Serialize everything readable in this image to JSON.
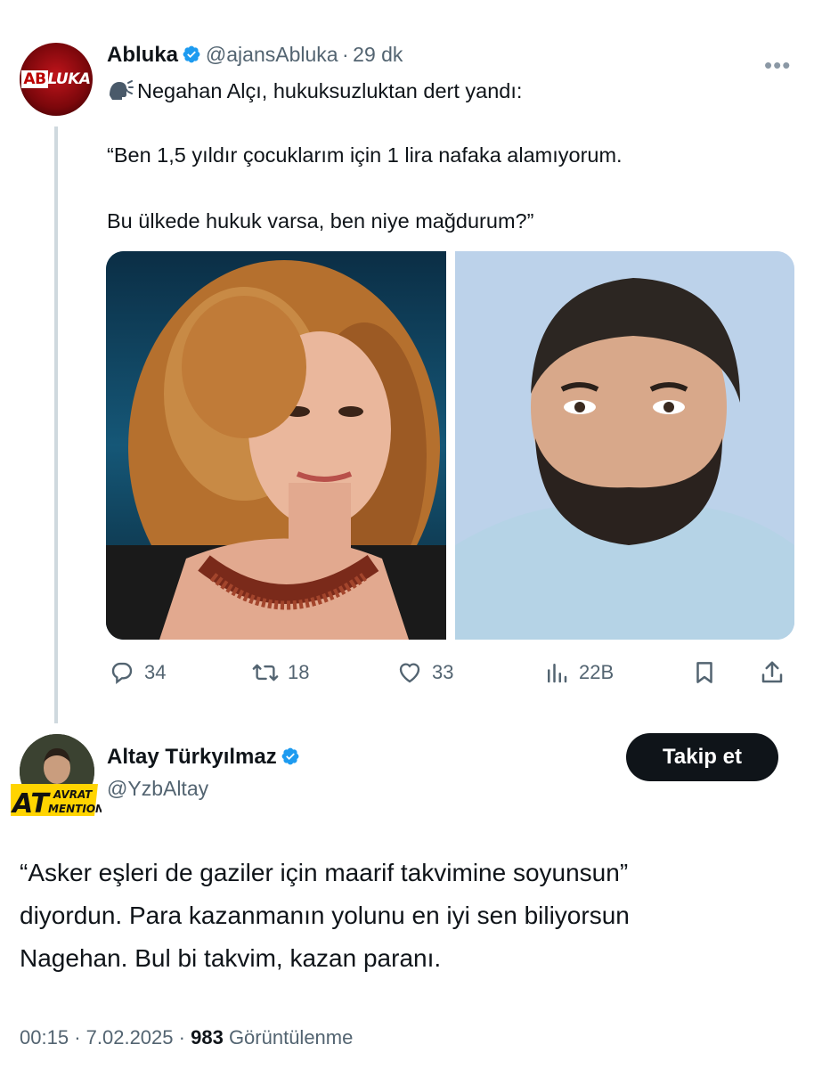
{
  "tweet1": {
    "author_name": "Abluka",
    "author_handle": "@ajansAbluka",
    "separator": "·",
    "time_ago": "29 dk",
    "avatar_text_ab": "AB",
    "avatar_text_luka": "LUKA",
    "text_line1": "Negahan Alçı, hukuksuzluktan dert yandı:",
    "text_line2": "“Ben 1,5 yıldır çocuklarım için 1 lira nafaka alamıyorum.",
    "text_line3": "Bu ülkede hukuk varsa, ben niye mağdurum?”",
    "stats": {
      "replies": "34",
      "retweets": "18",
      "likes": "33",
      "views": "22B"
    }
  },
  "tweet2": {
    "author_name": "Altay Türkyılmaz",
    "author_handle": "@YzbAltay",
    "follow_label": "Takip et",
    "badge_at": "AT",
    "badge_line1": "AVRAT",
    "badge_line2": "MENTION",
    "body_line1": "“Asker eşleri de gaziler için maarif takvimine soyunsun”",
    "body_line2": "diyordun. Para kazanmanın yolunu en iyi sen biliyorsun",
    "body_line3": "Nagehan. Bul bi takvim, kazan paranı.",
    "time": "00:15",
    "date": "7.02.2025",
    "separator": "·",
    "views_count": "983",
    "views_label": "Görüntülenme"
  },
  "colors": {
    "text": "#0f1419",
    "secondary": "#536471",
    "verified_blue": "#1d9bf0",
    "button_bg": "#0f1419"
  }
}
